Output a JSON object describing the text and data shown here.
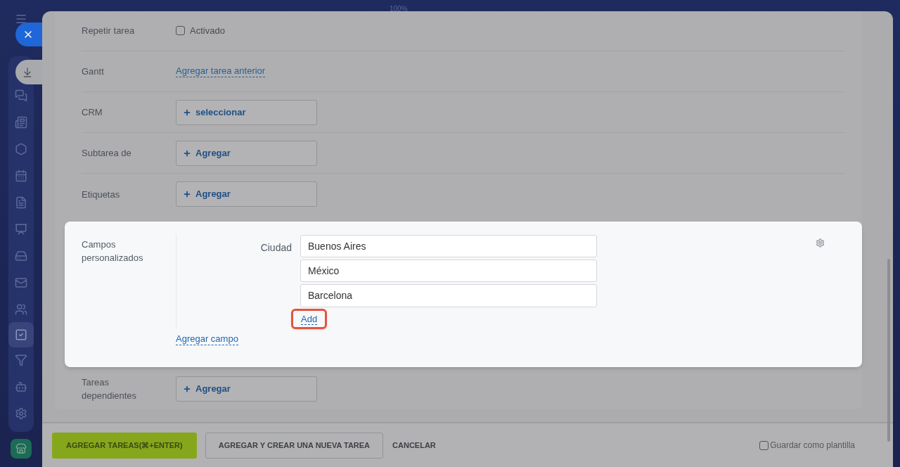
{
  "zoom_label": "100%",
  "sidebar": {
    "items": [
      {
        "selected": false
      },
      {
        "selected": false
      },
      {
        "selected": false
      },
      {
        "selected": false
      },
      {
        "selected": false
      },
      {
        "selected": false
      },
      {
        "selected": false
      },
      {
        "selected": false
      },
      {
        "selected": false
      },
      {
        "selected": true
      },
      {
        "selected": false
      },
      {
        "selected": false
      },
      {
        "selected": false
      }
    ]
  },
  "rows": [
    {
      "kind": "checkbox",
      "label": "Repetir tarea",
      "text": "Activado",
      "checked": false
    },
    {
      "kind": "link",
      "label": "Gantt",
      "text": "Agregar tarea anterior"
    },
    {
      "kind": "add_button",
      "label": "CRM",
      "text": "seleccionar"
    },
    {
      "kind": "add_button",
      "label": "Subtarea de",
      "text": "Agregar"
    },
    {
      "kind": "add_button",
      "label": "Etiquetas",
      "text": "Agregar"
    }
  ],
  "custom_fields": {
    "label": "Campos personalizados",
    "field_label": "Ciudad",
    "values": [
      "Buenos Aires",
      "México",
      "Barcelona"
    ],
    "add_link": {
      "text": "Add",
      "highlighted": true
    },
    "add_field_link": "Agregar campo"
  },
  "rows_after": [
    {
      "kind": "add_button",
      "label": "Tareas dependientes",
      "text": "Agregar"
    }
  ],
  "footer": {
    "buttons": [
      {
        "kind": "primary",
        "text": "AGREGAR TAREAS(⌘+ENTER)"
      },
      {
        "kind": "secondary",
        "text": "AGREGAR Y CREAR UNA NUEVA TAREA"
      },
      {
        "kind": "link",
        "text": "CANCELAR"
      }
    ],
    "save_template": {
      "text": "Guardar como plantilla",
      "checked": false
    }
  }
}
